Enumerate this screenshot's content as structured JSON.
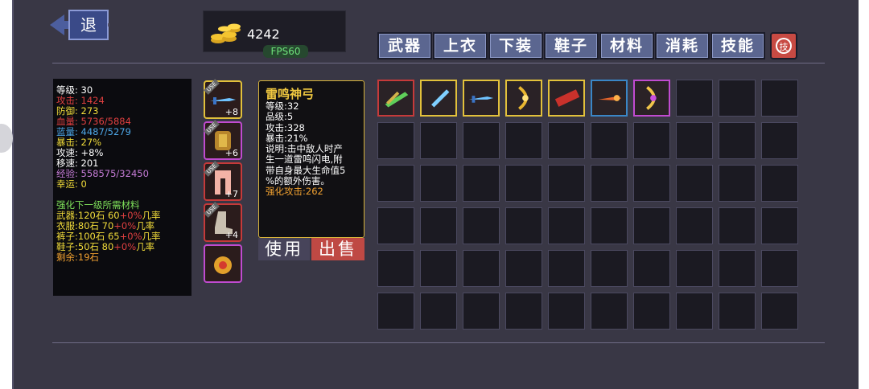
{
  "back": {
    "label": "退"
  },
  "gold": {
    "amount": "4242",
    "fps": "FPS60"
  },
  "tabs": [
    "武器",
    "上衣",
    "下装",
    "鞋子",
    "材料",
    "消耗",
    "技能"
  ],
  "close_icon": "skill-badge-icon",
  "stats": {
    "level": "等级: 30",
    "attack": "攻击: 1424",
    "defense": "防御: 273",
    "hp": "血量: 5736/5884",
    "mp": "蓝量: 4487/5279",
    "crit": "暴击: 27%",
    "attack_speed": "攻速: +8%",
    "move_speed": "移速: 201",
    "exp": "经验: 558575/32450",
    "luck": "幸运: 0",
    "upgrade_title": "强化下一级所需材料",
    "weapon_pre": "武器:120石 60",
    "clothes_pre": "衣服:80石 70",
    "pants_pre": "裤子:100石 65",
    "shoes_pre": "鞋子:50石 80",
    "bonus": "+0%",
    "rate": "几率",
    "remaining": "剩余:19石"
  },
  "equipped": [
    {
      "icon": "ice-sword-icon",
      "plus": "+8",
      "border": "#e2c13b",
      "use": "USE"
    },
    {
      "icon": "armor-icon",
      "plus": "+6",
      "border": "#c04bd0",
      "use": "USE"
    },
    {
      "icon": "pants-icon",
      "plus": "+7",
      "border": "#c63a3a",
      "use": "USE"
    },
    {
      "icon": "boots-icon",
      "plus": "+4",
      "border": "#c63a3a",
      "use": "USE"
    },
    {
      "icon": "amulet-icon",
      "plus": "",
      "border": "#c04bd0",
      "use": ""
    }
  ],
  "item": {
    "name": "雷鸣神弓",
    "level": "等级:32",
    "grade": "品级:5",
    "attack": "攻击:328",
    "crit": "暴击:21%",
    "desc1": "说明:击中敌人时产",
    "desc2": "生一道雷鸣闪电,附",
    "desc3": "带自身最大生命值5",
    "desc4": "%的额外伤害。",
    "enhance": "强化攻击:262"
  },
  "actions": {
    "use": "使用",
    "sell": "出售"
  },
  "inventory": [
    {
      "icon": "green-crossbow-icon",
      "border": "#c63a3a"
    },
    {
      "icon": "ice-blade-icon",
      "border": "#e2c13b"
    },
    {
      "icon": "ice-sword-icon",
      "border": "#e2c13b",
      "use": "USE"
    },
    {
      "icon": "golden-bow-icon",
      "border": "#e2c13b"
    },
    {
      "icon": "red-cannon-icon",
      "border": "#e2c13b"
    },
    {
      "icon": "fire-spear-icon",
      "border": "#3a86c6"
    },
    {
      "icon": "thunder-bow-icon",
      "border": "#c04bd0"
    }
  ],
  "colors": {
    "panel": "#393745",
    "tab": "#5b6690",
    "attack_red": "#e04040",
    "hp_red": "#e04040",
    "mp_blue": "#4da6e6",
    "exp_purple": "#c77dd8",
    "yellow": "#f2dc3a",
    "green": "#7ee05a",
    "orange": "#f1a130"
  }
}
